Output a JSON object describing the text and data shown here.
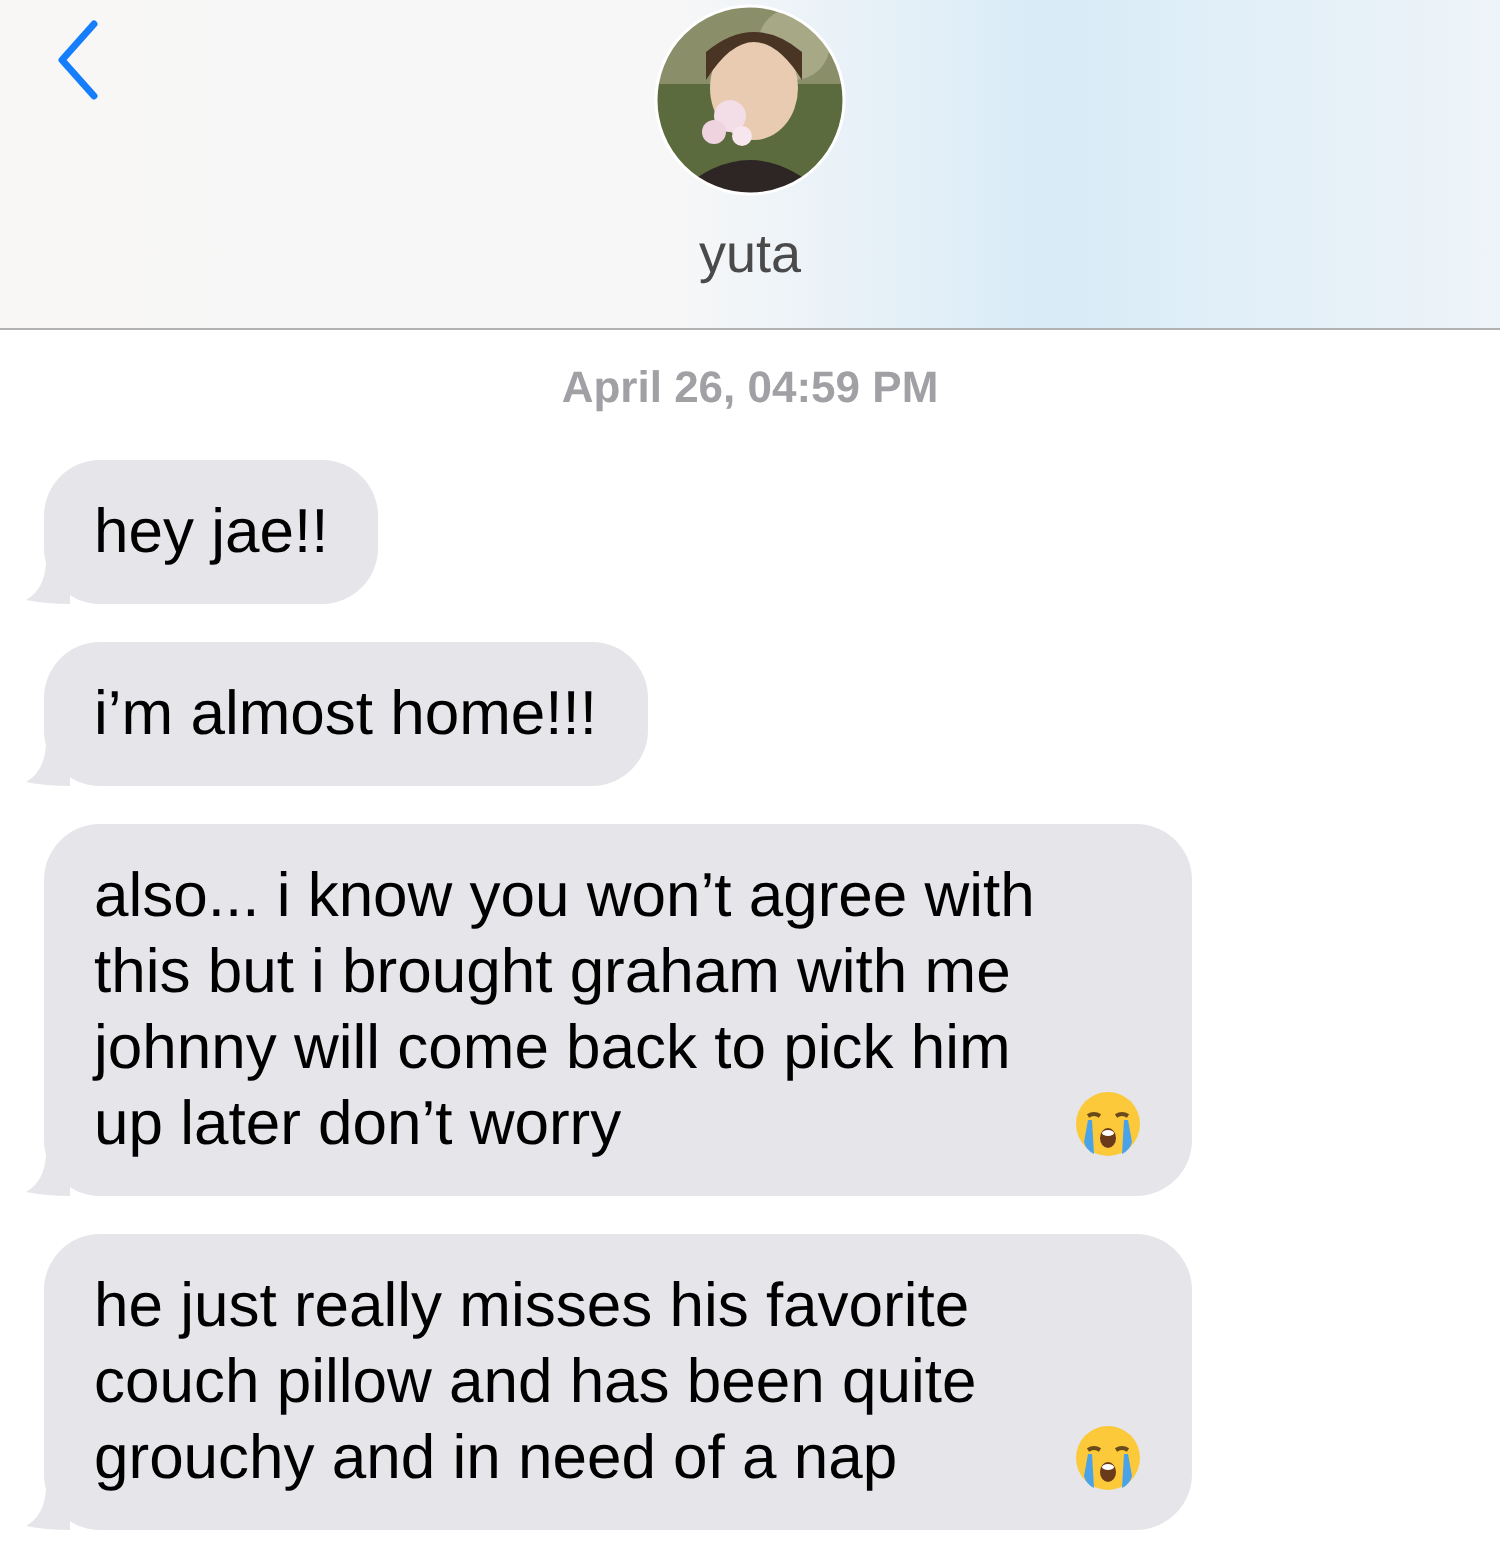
{
  "header": {
    "contact_name": "yuta"
  },
  "timestamp": "April 26, 04:59 PM",
  "messages": [
    {
      "text": "hey jae!!",
      "emoji": false
    },
    {
      "text": "i’m almost home!!!",
      "emoji": false
    },
    {
      "text": "also... i know you won’t agree with this but i brought graham with me johnny will come back to pick him up later don’t worry",
      "emoji": true
    },
    {
      "text": "he just really misses his favorite couch pillow and has been quite grouchy and in need of a nap",
      "emoji": true
    }
  ]
}
